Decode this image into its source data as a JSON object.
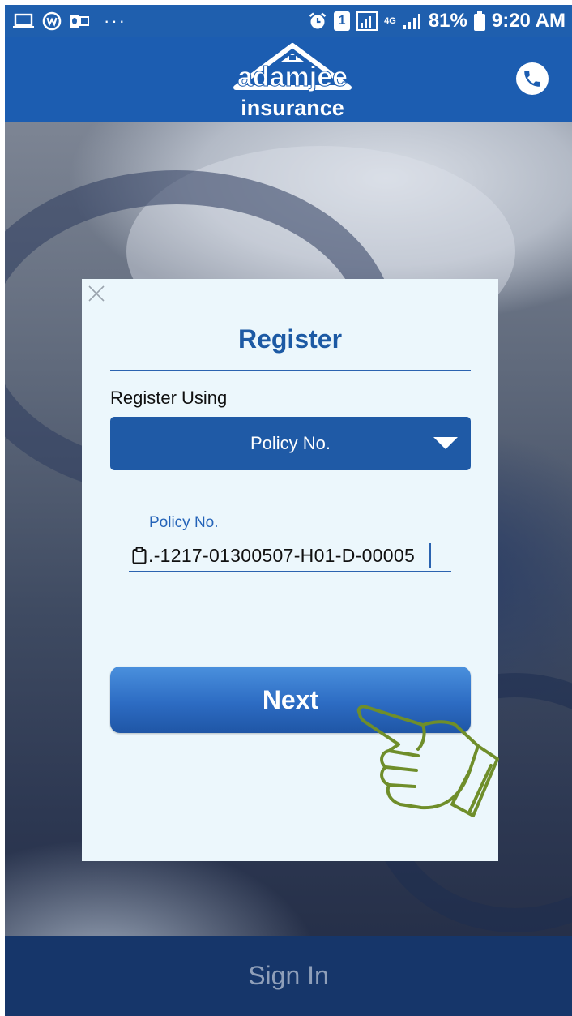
{
  "status_bar": {
    "battery": "81%",
    "time": "9:20 AM",
    "network": "4G",
    "sim": "1",
    "icons": [
      "laptop-icon",
      "circle-w-icon",
      "outlook-icon",
      "more-icon",
      "alarm-icon",
      "sim-icon",
      "signal-icon",
      "battery-icon"
    ]
  },
  "header": {
    "logo_top": "adamjee",
    "logo_bottom": "insurance",
    "phone_icon": "phone-icon"
  },
  "dialog": {
    "title": "Register",
    "register_using_label": "Register Using",
    "select_value": "Policy No.",
    "field_label": "Policy No.",
    "field_value": ".-1217-01300507-H01-D-00005",
    "next_label": "Next"
  },
  "footer": {
    "sign_in_label": "Sign In"
  },
  "colors": {
    "brand_blue": "#1c5db1",
    "dialog_bg": "#ecf7fc",
    "footer_bg": "#16366a",
    "hand_green": "#6f8e2a"
  }
}
